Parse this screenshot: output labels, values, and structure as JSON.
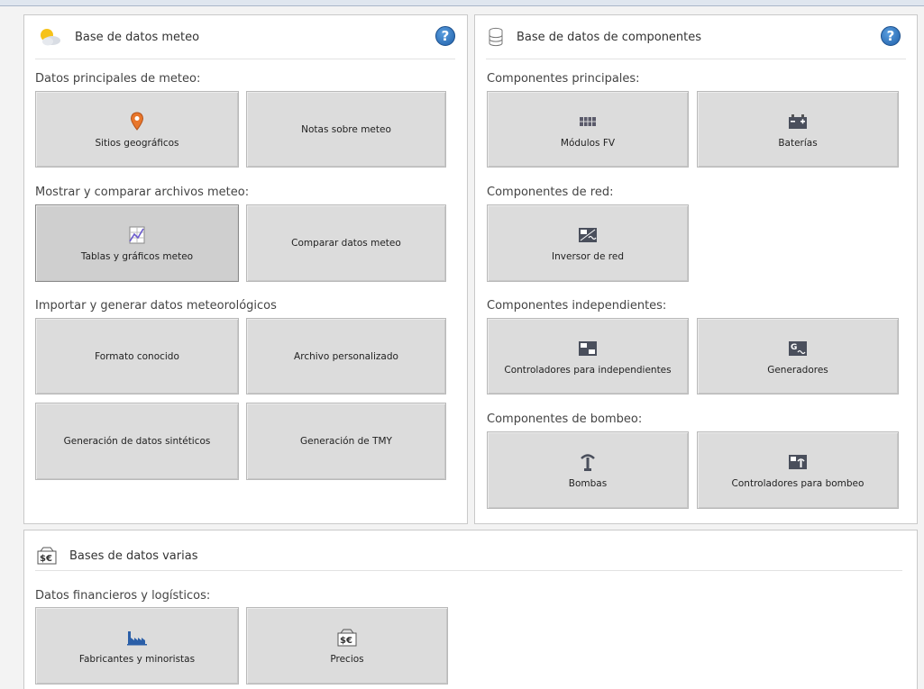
{
  "meteo": {
    "title": "Base de datos meteo",
    "help": "?",
    "sections": [
      {
        "label": "Datos principales de meteo:",
        "buttons": [
          {
            "label": "Sitios geográficos",
            "icon": "location-pin-icon"
          },
          {
            "label": "Notas sobre meteo"
          }
        ]
      },
      {
        "label": "Mostrar y comparar archivos meteo:",
        "buttons": [
          {
            "label": "Tablas y gráficos meteo",
            "icon": "chart-table-icon",
            "selected": true
          },
          {
            "label": "Comparar datos meteo"
          }
        ]
      },
      {
        "label": "Importar y generar datos meteorológicos",
        "buttons": [
          {
            "label": "Formato conocido"
          },
          {
            "label": "Archivo personalizado"
          },
          {
            "label": "Generación de datos sintéticos"
          },
          {
            "label": "Generación de TMY"
          }
        ]
      }
    ]
  },
  "components": {
    "title": "Base de datos de componentes",
    "help": "?",
    "sections": [
      {
        "label": "Componentes principales:",
        "buttons": [
          {
            "label": "Módulos FV",
            "icon": "pv-module-icon"
          },
          {
            "label": "Baterías",
            "icon": "battery-icon"
          }
        ]
      },
      {
        "label": "Componentes de red:",
        "buttons": [
          {
            "label": "Inversor de red",
            "icon": "inverter-icon"
          }
        ]
      },
      {
        "label": "Componentes independientes:",
        "buttons": [
          {
            "label": "Controladores para independientes",
            "icon": "controller-icon"
          },
          {
            "label": "Generadores",
            "icon": "generator-icon"
          }
        ]
      },
      {
        "label": "Componentes de bombeo:",
        "buttons": [
          {
            "label": "Bombas",
            "icon": "pump-icon"
          },
          {
            "label": "Controladores para bombeo",
            "icon": "pump-controller-icon"
          }
        ]
      }
    ]
  },
  "misc": {
    "title": "Bases de datos varias",
    "sections": [
      {
        "label": "Datos financieros y logísticos:",
        "buttons": [
          {
            "label": "Fabricantes y minoristas",
            "icon": "factory-icon"
          },
          {
            "label": "Precios",
            "icon": "prices-icon"
          }
        ]
      }
    ]
  },
  "colors": {
    "button_bg": "#dcdcdc",
    "help_blue": "#2a6fbf",
    "pin_orange": "#e8762b"
  }
}
